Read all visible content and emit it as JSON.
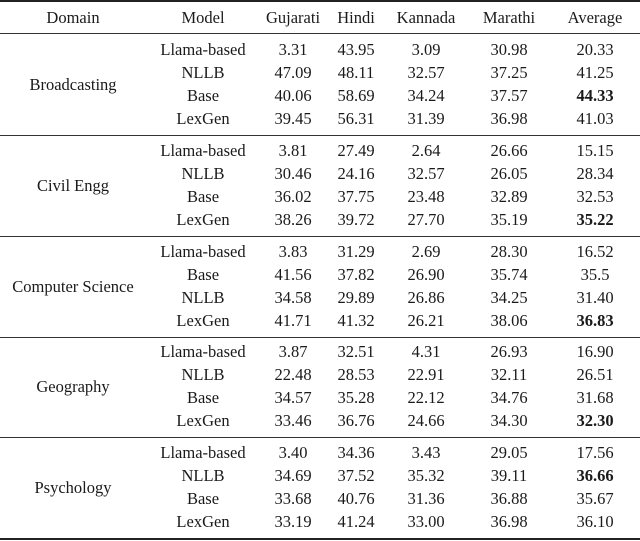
{
  "table": {
    "headers": [
      "Domain",
      "Model",
      "Gujarati",
      "Hindi",
      "Kannada",
      "Marathi",
      "Average"
    ],
    "sections": [
      {
        "domain": "Broadcasting",
        "rows": [
          {
            "model": "Llama-based",
            "gujarati": "3.31",
            "hindi": "43.95",
            "kannada": "3.09",
            "marathi": "30.98",
            "average": "20.33",
            "bold": false
          },
          {
            "model": "NLLB",
            "gujarati": "47.09",
            "hindi": "48.11",
            "kannada": "32.57",
            "marathi": "37.25",
            "average": "41.25",
            "bold": false
          },
          {
            "model": "Base",
            "gujarati": "40.06",
            "hindi": "58.69",
            "kannada": "34.24",
            "marathi": "37.57",
            "average": "44.33",
            "bold": true
          },
          {
            "model": "LexGen",
            "gujarati": "39.45",
            "hindi": "56.31",
            "kannada": "31.39",
            "marathi": "36.98",
            "average": "41.03",
            "bold": false
          }
        ]
      },
      {
        "domain": "Civil Engg",
        "rows": [
          {
            "model": "Llama-based",
            "gujarati": "3.81",
            "hindi": "27.49",
            "kannada": "2.64",
            "marathi": "26.66",
            "average": "15.15",
            "bold": false
          },
          {
            "model": "NLLB",
            "gujarati": "30.46",
            "hindi": "24.16",
            "kannada": "32.57",
            "marathi": "26.05",
            "average": "28.34",
            "bold": false
          },
          {
            "model": "Base",
            "gujarati": "36.02",
            "hindi": "37.75",
            "kannada": "23.48",
            "marathi": "32.89",
            "average": "32.53",
            "bold": false
          },
          {
            "model": "LexGen",
            "gujarati": "38.26",
            "hindi": "39.72",
            "kannada": "27.70",
            "marathi": "35.19",
            "average": "35.22",
            "bold": true
          }
        ]
      },
      {
        "domain": "Computer Science",
        "rows": [
          {
            "model": "Llama-based",
            "gujarati": "3.83",
            "hindi": "31.29",
            "kannada": "2.69",
            "marathi": "28.30",
            "average": "16.52",
            "bold": false
          },
          {
            "model": "Base",
            "gujarati": "41.56",
            "hindi": "37.82",
            "kannada": "26.90",
            "marathi": "35.74",
            "average": "35.5",
            "bold": false
          },
          {
            "model": "NLLB",
            "gujarati": "34.58",
            "hindi": "29.89",
            "kannada": "26.86",
            "marathi": "34.25",
            "average": "31.40",
            "bold": false
          },
          {
            "model": "LexGen",
            "gujarati": "41.71",
            "hindi": "41.32",
            "kannada": "26.21",
            "marathi": "38.06",
            "average": "36.83",
            "bold": true
          }
        ]
      },
      {
        "domain": "Geography",
        "rows": [
          {
            "model": "Llama-based",
            "gujarati": "3.87",
            "hindi": "32.51",
            "kannada": "4.31",
            "marathi": "26.93",
            "average": "16.90",
            "bold": false
          },
          {
            "model": "NLLB",
            "gujarati": "22.48",
            "hindi": "28.53",
            "kannada": "22.91",
            "marathi": "32.11",
            "average": "26.51",
            "bold": false
          },
          {
            "model": "Base",
            "gujarati": "34.57",
            "hindi": "35.28",
            "kannada": "22.12",
            "marathi": "34.76",
            "average": "31.68",
            "bold": false
          },
          {
            "model": "LexGen",
            "gujarati": "33.46",
            "hindi": "36.76",
            "kannada": "24.66",
            "marathi": "34.30",
            "average": "32.30",
            "bold": true
          }
        ]
      },
      {
        "domain": "Psychology",
        "rows": [
          {
            "model": "Llama-based",
            "gujarati": "3.40",
            "hindi": "34.36",
            "kannada": "3.43",
            "marathi": "29.05",
            "average": "17.56",
            "bold": false
          },
          {
            "model": "NLLB",
            "gujarati": "34.69",
            "hindi": "37.52",
            "kannada": "35.32",
            "marathi": "39.11",
            "average": "36.66",
            "bold": true
          },
          {
            "model": "Base",
            "gujarati": "33.68",
            "hindi": "40.76",
            "kannada": "31.36",
            "marathi": "36.88",
            "average": "35.67",
            "bold": false
          },
          {
            "model": "LexGen",
            "gujarati": "33.19",
            "hindi": "41.24",
            "kannada": "33.00",
            "marathi": "36.98",
            "average": "36.10",
            "bold": false
          }
        ]
      }
    ]
  }
}
